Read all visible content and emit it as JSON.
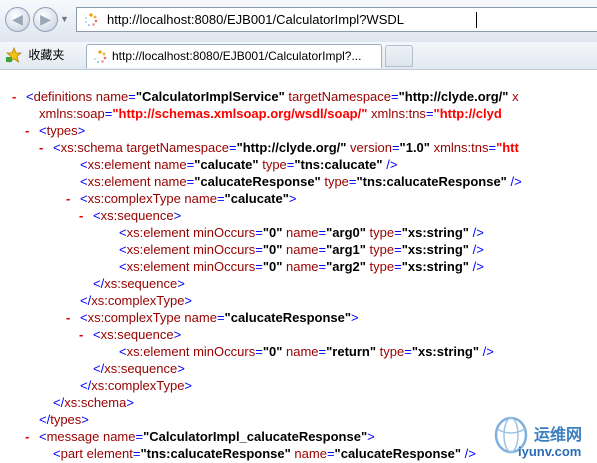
{
  "browser": {
    "address_url": "http://localhost:8080/EJB001/CalculatorImpl?WSDL",
    "favorites_label": "收藏夹",
    "tab_title": "http://localhost:8080/EJB001/CalculatorImpl?..."
  },
  "xml_lines": [
    {
      "indent": 0,
      "toggle": "-",
      "parts": [
        [
          "p",
          "<"
        ],
        [
          "el",
          "definitions"
        ],
        [
          "t",
          " "
        ],
        [
          "an",
          "name"
        ],
        [
          "eq",
          "="
        ],
        [
          "av",
          "\"CalculatorImplService\""
        ],
        [
          "t",
          " "
        ],
        [
          "an",
          "targetNamespace"
        ],
        [
          "eq",
          "="
        ],
        [
          "av",
          "\"http://clyde.org/\""
        ],
        [
          "t",
          " "
        ],
        [
          "an",
          "x"
        ]
      ]
    },
    {
      "indent": 1,
      "toggle": "",
      "parts": [
        [
          "an",
          "xmlns:soap"
        ],
        [
          "eq",
          "="
        ],
        [
          "avns",
          "\"http://schemas.xmlsoap.org/wsdl/soap/\""
        ],
        [
          "t",
          " "
        ],
        [
          "an",
          "xmlns:tns"
        ],
        [
          "eq",
          "="
        ],
        [
          "avns",
          "\"http://clyd"
        ]
      ]
    },
    {
      "indent": 1,
      "toggle": "-",
      "parts": [
        [
          "p",
          "<"
        ],
        [
          "el",
          "types"
        ],
        [
          "p",
          ">"
        ]
      ]
    },
    {
      "indent": 2,
      "toggle": "-",
      "parts": [
        [
          "p",
          "<"
        ],
        [
          "el",
          "xs:schema"
        ],
        [
          "t",
          " "
        ],
        [
          "an",
          "targetNamespace"
        ],
        [
          "eq",
          "="
        ],
        [
          "av",
          "\"http://clyde.org/\""
        ],
        [
          "t",
          " "
        ],
        [
          "an",
          "version"
        ],
        [
          "eq",
          "="
        ],
        [
          "av",
          "\"1.0\""
        ],
        [
          "t",
          " "
        ],
        [
          "an",
          "xmlns:tns"
        ],
        [
          "eq",
          "="
        ],
        [
          "avns",
          "\"htt"
        ]
      ]
    },
    {
      "indent": 3,
      "toggle": "",
      "parts": [
        [
          "p",
          "<"
        ],
        [
          "el",
          "xs:element"
        ],
        [
          "t",
          " "
        ],
        [
          "an",
          "name"
        ],
        [
          "eq",
          "="
        ],
        [
          "av",
          "\"calucate\""
        ],
        [
          "t",
          " "
        ],
        [
          "an",
          "type"
        ],
        [
          "eq",
          "="
        ],
        [
          "av",
          "\"tns:calucate\""
        ],
        [
          "t",
          " "
        ],
        [
          "p",
          "/>"
        ]
      ]
    },
    {
      "indent": 3,
      "toggle": "",
      "parts": [
        [
          "p",
          "<"
        ],
        [
          "el",
          "xs:element"
        ],
        [
          "t",
          " "
        ],
        [
          "an",
          "name"
        ],
        [
          "eq",
          "="
        ],
        [
          "av",
          "\"calucateResponse\""
        ],
        [
          "t",
          " "
        ],
        [
          "an",
          "type"
        ],
        [
          "eq",
          "="
        ],
        [
          "av",
          "\"tns:calucateResponse\""
        ],
        [
          "t",
          " "
        ],
        [
          "p",
          "/>"
        ]
      ]
    },
    {
      "indent": 3,
      "toggle": "-",
      "parts": [
        [
          "p",
          "<"
        ],
        [
          "el",
          "xs:complexType"
        ],
        [
          "t",
          " "
        ],
        [
          "an",
          "name"
        ],
        [
          "eq",
          "="
        ],
        [
          "av",
          "\"calucate\""
        ],
        [
          "p",
          ">"
        ]
      ]
    },
    {
      "indent": 4,
      "toggle": "-",
      "parts": [
        [
          "p",
          "<"
        ],
        [
          "el",
          "xs:sequence"
        ],
        [
          "p",
          ">"
        ]
      ]
    },
    {
      "indent": 5,
      "toggle": "",
      "parts": [
        [
          "p",
          "<"
        ],
        [
          "el",
          "xs:element"
        ],
        [
          "t",
          " "
        ],
        [
          "an",
          "minOccurs"
        ],
        [
          "eq",
          "="
        ],
        [
          "av",
          "\"0\""
        ],
        [
          "t",
          " "
        ],
        [
          "an",
          "name"
        ],
        [
          "eq",
          "="
        ],
        [
          "av",
          "\"arg0\""
        ],
        [
          "t",
          " "
        ],
        [
          "an",
          "type"
        ],
        [
          "eq",
          "="
        ],
        [
          "av",
          "\"xs:string\""
        ],
        [
          "t",
          " "
        ],
        [
          "p",
          "/>"
        ]
      ]
    },
    {
      "indent": 5,
      "toggle": "",
      "parts": [
        [
          "p",
          "<"
        ],
        [
          "el",
          "xs:element"
        ],
        [
          "t",
          " "
        ],
        [
          "an",
          "minOccurs"
        ],
        [
          "eq",
          "="
        ],
        [
          "av",
          "\"0\""
        ],
        [
          "t",
          " "
        ],
        [
          "an",
          "name"
        ],
        [
          "eq",
          "="
        ],
        [
          "av",
          "\"arg1\""
        ],
        [
          "t",
          " "
        ],
        [
          "an",
          "type"
        ],
        [
          "eq",
          "="
        ],
        [
          "av",
          "\"xs:string\""
        ],
        [
          "t",
          " "
        ],
        [
          "p",
          "/>"
        ]
      ]
    },
    {
      "indent": 5,
      "toggle": "",
      "parts": [
        [
          "p",
          "<"
        ],
        [
          "el",
          "xs:element"
        ],
        [
          "t",
          " "
        ],
        [
          "an",
          "minOccurs"
        ],
        [
          "eq",
          "="
        ],
        [
          "av",
          "\"0\""
        ],
        [
          "t",
          " "
        ],
        [
          "an",
          "name"
        ],
        [
          "eq",
          "="
        ],
        [
          "av",
          "\"arg2\""
        ],
        [
          "t",
          " "
        ],
        [
          "an",
          "type"
        ],
        [
          "eq",
          "="
        ],
        [
          "av",
          "\"xs:string\""
        ],
        [
          "t",
          " "
        ],
        [
          "p",
          "/>"
        ]
      ]
    },
    {
      "indent": 4,
      "toggle": "",
      "parts": [
        [
          "p",
          "</"
        ],
        [
          "el",
          "xs:sequence"
        ],
        [
          "p",
          ">"
        ]
      ]
    },
    {
      "indent": 3,
      "toggle": "",
      "parts": [
        [
          "p",
          "</"
        ],
        [
          "el",
          "xs:complexType"
        ],
        [
          "p",
          ">"
        ]
      ]
    },
    {
      "indent": 3,
      "toggle": "-",
      "parts": [
        [
          "p",
          "<"
        ],
        [
          "el",
          "xs:complexType"
        ],
        [
          "t",
          " "
        ],
        [
          "an",
          "name"
        ],
        [
          "eq",
          "="
        ],
        [
          "av",
          "\"calucateResponse\""
        ],
        [
          "p",
          ">"
        ]
      ]
    },
    {
      "indent": 4,
      "toggle": "-",
      "parts": [
        [
          "p",
          "<"
        ],
        [
          "el",
          "xs:sequence"
        ],
        [
          "p",
          ">"
        ]
      ]
    },
    {
      "indent": 5,
      "toggle": "",
      "parts": [
        [
          "p",
          "<"
        ],
        [
          "el",
          "xs:element"
        ],
        [
          "t",
          " "
        ],
        [
          "an",
          "minOccurs"
        ],
        [
          "eq",
          "="
        ],
        [
          "av",
          "\"0\""
        ],
        [
          "t",
          " "
        ],
        [
          "an",
          "name"
        ],
        [
          "eq",
          "="
        ],
        [
          "av",
          "\"return\""
        ],
        [
          "t",
          " "
        ],
        [
          "an",
          "type"
        ],
        [
          "eq",
          "="
        ],
        [
          "av",
          "\"xs:string\""
        ],
        [
          "t",
          " "
        ],
        [
          "p",
          "/>"
        ]
      ]
    },
    {
      "indent": 4,
      "toggle": "",
      "parts": [
        [
          "p",
          "</"
        ],
        [
          "el",
          "xs:sequence"
        ],
        [
          "p",
          ">"
        ]
      ]
    },
    {
      "indent": 3,
      "toggle": "",
      "parts": [
        [
          "p",
          "</"
        ],
        [
          "el",
          "xs:complexType"
        ],
        [
          "p",
          ">"
        ]
      ]
    },
    {
      "indent": 2,
      "toggle": "",
      "parts": [
        [
          "p",
          "</"
        ],
        [
          "el",
          "xs:schema"
        ],
        [
          "p",
          ">"
        ]
      ]
    },
    {
      "indent": 1,
      "toggle": "",
      "parts": [
        [
          "p",
          "</"
        ],
        [
          "el",
          "types"
        ],
        [
          "p",
          ">"
        ]
      ]
    },
    {
      "indent": 1,
      "toggle": "-",
      "parts": [
        [
          "p",
          "<"
        ],
        [
          "el",
          "message"
        ],
        [
          "t",
          " "
        ],
        [
          "an",
          "name"
        ],
        [
          "eq",
          "="
        ],
        [
          "av",
          "\"CalculatorImpl_calucateResponse\""
        ],
        [
          "p",
          ">"
        ]
      ]
    },
    {
      "indent": 2,
      "toggle": "",
      "parts": [
        [
          "p",
          "<"
        ],
        [
          "el",
          "part"
        ],
        [
          "t",
          " "
        ],
        [
          "an",
          "element"
        ],
        [
          "eq",
          "="
        ],
        [
          "av",
          "\"tns:calucateResponse\""
        ],
        [
          "t",
          " "
        ],
        [
          "an",
          "name"
        ],
        [
          "eq",
          "="
        ],
        [
          "av",
          "\"calucateResponse\""
        ],
        [
          "t",
          " "
        ],
        [
          "p",
          "/>"
        ]
      ]
    }
  ],
  "watermark": {
    "brand_text": "运维网",
    "domain_text": "iyunv.com"
  },
  "colors": {
    "tag_punct": "#0000ff",
    "tag_name": "#990000",
    "attr_value": "#000000",
    "ns_value": "#ff0000",
    "toggle": "#e00000"
  }
}
